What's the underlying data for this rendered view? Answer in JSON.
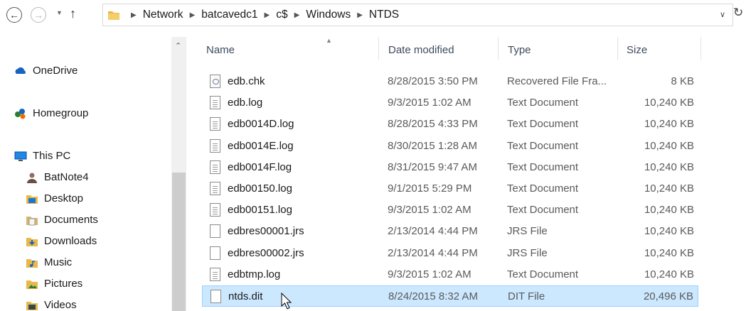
{
  "address": {
    "crumbs": [
      "Network",
      "batcavedc1",
      "c$",
      "Windows",
      "NTDS"
    ]
  },
  "nav": {
    "groups": [
      {
        "label": "OneDrive",
        "icon": "cloud-icon"
      },
      {
        "label": "Homegroup",
        "icon": "homegroup-icon"
      },
      {
        "label": "This PC",
        "icon": "computer-icon"
      }
    ],
    "items": [
      {
        "label": "BatNote4",
        "icon": "user-folder-icon"
      },
      {
        "label": "Desktop",
        "icon": "desktop-folder-icon"
      },
      {
        "label": "Documents",
        "icon": "documents-folder-icon"
      },
      {
        "label": "Downloads",
        "icon": "downloads-folder-icon"
      },
      {
        "label": "Music",
        "icon": "music-folder-icon"
      },
      {
        "label": "Pictures",
        "icon": "pictures-folder-icon"
      },
      {
        "label": "Videos",
        "icon": "videos-folder-icon"
      }
    ]
  },
  "columns": {
    "name": "Name",
    "date": "Date modified",
    "type": "Type",
    "size": "Size"
  },
  "files": [
    {
      "name": "edb.chk",
      "date": "8/28/2015 3:50 PM",
      "type": "Recovered File Fra...",
      "size": "8 KB",
      "icon": "chk-file-icon"
    },
    {
      "name": "edb.log",
      "date": "9/3/2015 1:02 AM",
      "type": "Text Document",
      "size": "10,240 KB",
      "icon": "text-file-icon"
    },
    {
      "name": "edb0014D.log",
      "date": "8/28/2015 4:33 PM",
      "type": "Text Document",
      "size": "10,240 KB",
      "icon": "text-file-icon"
    },
    {
      "name": "edb0014E.log",
      "date": "8/30/2015 1:28 AM",
      "type": "Text Document",
      "size": "10,240 KB",
      "icon": "text-file-icon"
    },
    {
      "name": "edb0014F.log",
      "date": "8/31/2015 9:47 AM",
      "type": "Text Document",
      "size": "10,240 KB",
      "icon": "text-file-icon"
    },
    {
      "name": "edb00150.log",
      "date": "9/1/2015 5:29 PM",
      "type": "Text Document",
      "size": "10,240 KB",
      "icon": "text-file-icon"
    },
    {
      "name": "edb00151.log",
      "date": "9/3/2015 1:02 AM",
      "type": "Text Document",
      "size": "10,240 KB",
      "icon": "text-file-icon"
    },
    {
      "name": "edbres00001.jrs",
      "date": "2/13/2014 4:44 PM",
      "type": "JRS File",
      "size": "10,240 KB",
      "icon": "blank-file-icon"
    },
    {
      "name": "edbres00002.jrs",
      "date": "2/13/2014 4:44 PM",
      "type": "JRS File",
      "size": "10,240 KB",
      "icon": "blank-file-icon"
    },
    {
      "name": "edbtmp.log",
      "date": "9/3/2015 1:02 AM",
      "type": "Text Document",
      "size": "10,240 KB",
      "icon": "text-file-icon"
    },
    {
      "name": "ntds.dit",
      "date": "8/24/2015 8:32 AM",
      "type": "DIT File",
      "size": "20,496 KB",
      "icon": "blank-file-icon",
      "selected": true
    }
  ],
  "colors": {
    "selection": "#cce8ff",
    "selection_border": "#99d1ff"
  }
}
